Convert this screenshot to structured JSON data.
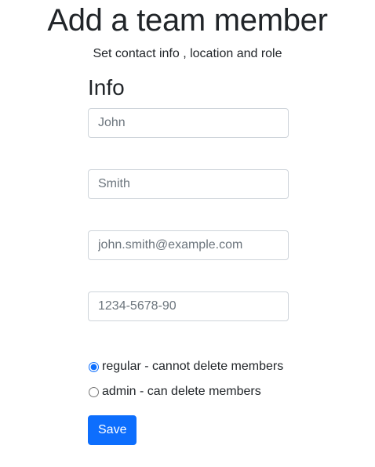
{
  "header": {
    "title": "Add a team member",
    "subtitle": "Set contact info , location and role"
  },
  "info": {
    "heading": "Info",
    "fields": {
      "first_name": {
        "value": "",
        "placeholder": "John"
      },
      "last_name": {
        "value": "",
        "placeholder": "Smith"
      },
      "email": {
        "value": "",
        "placeholder": "john.smith@example.com"
      },
      "phone": {
        "value": "",
        "placeholder": "1234-5678-90"
      }
    }
  },
  "roles": {
    "options": [
      {
        "label": "regular - cannot delete members",
        "checked": true
      },
      {
        "label": "admin - can delete members",
        "checked": false
      }
    ]
  },
  "actions": {
    "save_label": "Save"
  },
  "colors": {
    "primary": "#0d6efd",
    "text": "#212529",
    "placeholder": "#6c757d",
    "border": "#ced4da"
  }
}
